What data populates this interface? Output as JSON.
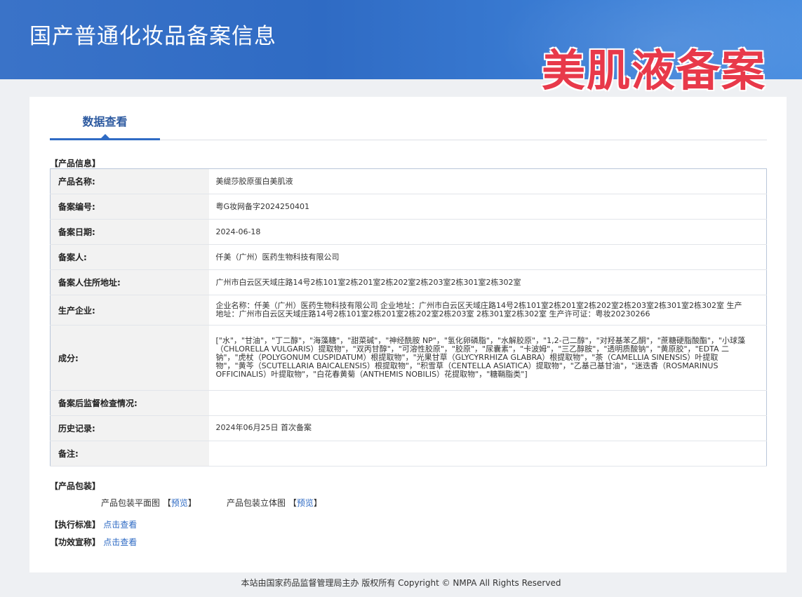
{
  "header": {
    "site_title": "国产普通化妆品备案信息",
    "watermark": "美肌液备案"
  },
  "tabs": [
    {
      "label": "数据查看"
    }
  ],
  "product_info": {
    "section_title": "【产品信息】",
    "rows": [
      {
        "key": "产品名称:",
        "value": "美缇莎胶原蛋白美肌液"
      },
      {
        "key": "备案编号:",
        "value": "粤G妆网备字2024250401"
      },
      {
        "key": "备案日期:",
        "value": "2024-06-18"
      },
      {
        "key": "备案人:",
        "value": "仟美（广州）医药生物科技有限公司"
      },
      {
        "key": "备案人住所地址:",
        "value": "广州市白云区天域庄路14号2栋101室2栋201室2栋202室2栋203室2栋301室2栋302室"
      },
      {
        "key": "生产企业:",
        "value": "企业名称：仟美（广州）医药生物科技有限公司 企业地址：广州市白云区天域庄路14号2栋101室2栋201室2栋202室2栋203室2栋301室2栋302室 生产地址：广州市白云区天域庄路14号2栋101室2栋201室2栋202室2栋203室 2栋301室2栋302室 生产许可证：粤妆20230266"
      },
      {
        "key": "成分:",
        "value": "[\"水\"，\"甘油\"，\"丁二醇\"，\"海藻糖\"，\"甜菜碱\"，\"神经酰胺 NP\"，\"氢化卵磷脂\"，\"水解胶原\"，\"1,2-己二醇\"，\"对羟基苯乙酮\"，\"蔗糖硬脂酸酯\"，\"小球藻（CHLORELLA VULGARIS）提取物\"，\"双丙甘醇\"，\"可溶性胶原\"，\"胶原\"，\"尿囊素\"，\"卡波姆\"，\"三乙醇胺\"，\"透明质酸钠\"，\"黄原胶\"，\"EDTA 二钠\"，\"虎杖（POLYGONUM CUSPIDATUM）根提取物\"，\"光果甘草（GLYCYRRHIZA GLABRA）根提取物\"，\"茶（CAMELLIA SINENSIS）叶提取物\"，\"黄芩（SCUTELLARIA BAICALENSIS）根提取物\"，\"积雪草（CENTELLA ASIATICA）提取物\"，\"乙基己基甘油\"，\"迷迭香（ROSMARINUS OFFICINALIS）叶提取物\"，\"白花春黄菊（ANTHEMIS NOBILIS）花提取物\"，\"糖鞘脂类\"]"
      },
      {
        "key": "备案后监督检查情况:",
        "value": ""
      },
      {
        "key": "历史记录:",
        "value": "2024年06月25日 首次备案"
      },
      {
        "key": "备注:",
        "value": ""
      }
    ]
  },
  "packaging": {
    "section_title": "【产品包装】",
    "flat_label": "产品包装平面图",
    "solid_label": "产品包装立体图",
    "bracket_open": "【",
    "bracket_close": "】",
    "preview_label": "预览"
  },
  "standard": {
    "label": "【执行标准】",
    "link": "点击查看"
  },
  "efficacy": {
    "label": "【功效宣称】",
    "link": "点击查看"
  },
  "footer": {
    "text": "本站由国家药品监督管理局主办 版权所有 Copyright © NMPA All Rights Reserved"
  }
}
